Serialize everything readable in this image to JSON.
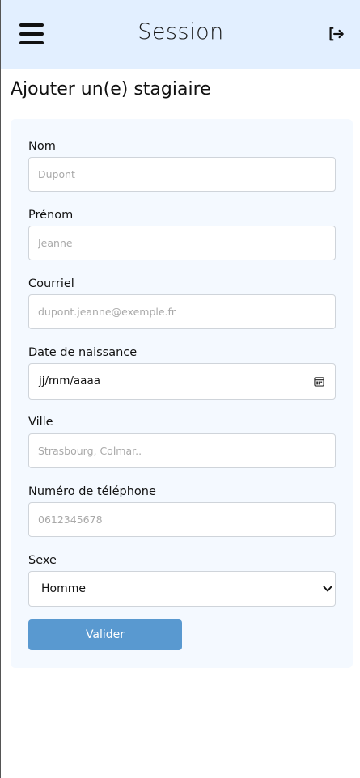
{
  "header": {
    "title": "Session",
    "menu_icon": "hamburger-menu-icon",
    "logout_icon": "logout-icon"
  },
  "page": {
    "title": "Ajouter un(e) stagiaire"
  },
  "form": {
    "nom": {
      "label": "Nom",
      "placeholder": "Dupont"
    },
    "prenom": {
      "label": "Prénom",
      "placeholder": "Jeanne"
    },
    "courriel": {
      "label": "Courriel",
      "placeholder": "dupont.jeanne@exemple.fr"
    },
    "date_naissance": {
      "label": "Date de naissance",
      "value": "jj/mm/aaaa",
      "icon": "calendar-icon"
    },
    "ville": {
      "label": "Ville",
      "placeholder": "Strasbourg, Colmar.."
    },
    "telephone": {
      "label": "Numéro de téléphone",
      "placeholder": "0612345678"
    },
    "sexe": {
      "label": "Sexe",
      "selected": "Homme",
      "icon": "chevron-down-icon"
    },
    "submit_label": "Valider"
  },
  "colors": {
    "header_bg": "#e2efff",
    "card_bg": "#f4f9ff",
    "button_bg": "#5999d0"
  }
}
